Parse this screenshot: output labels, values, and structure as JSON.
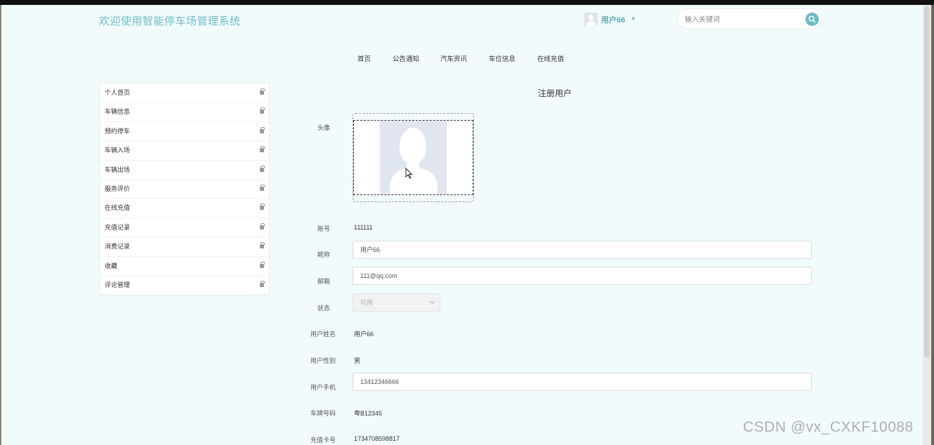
{
  "header": {
    "site_title": "欢迎使用智能停车场管理系统",
    "user_name": "用户66",
    "search_placeholder": "输入关键词"
  },
  "nav": [
    "首页",
    "公告通知",
    "汽车资讯",
    "车位信息",
    "在线充值"
  ],
  "sidebar": {
    "items": [
      "个人首页",
      "车辆信息",
      "预约停车",
      "车辆入场",
      "车辆出场",
      "服务评价",
      "在线充值",
      "充值记录",
      "消费记录",
      "收藏",
      "评论管理"
    ]
  },
  "form": {
    "title": "注册用户",
    "avatar_label": "头像",
    "account_label": "账号",
    "account_value": "111111",
    "nickname_label": "昵称",
    "nickname_value": "用户66",
    "email_label": "邮箱",
    "email_value": "111@qq.com",
    "status_label": "状态",
    "status_value": "可用",
    "realname_label": "用户姓名",
    "realname_value": "用户66",
    "gender_label": "用户性别",
    "gender_value": "男",
    "phone_label": "用户手机",
    "phone_value": "13412346666",
    "plate_label": "车牌号码",
    "plate_value": "粤B12345",
    "card_label": "充值卡号",
    "card_value": "1734708598817"
  },
  "watermark": "CSDN @vx_CXKF10088",
  "colors": {
    "accent": "#6cbcc8",
    "page_bg": "#f2fbfc"
  }
}
